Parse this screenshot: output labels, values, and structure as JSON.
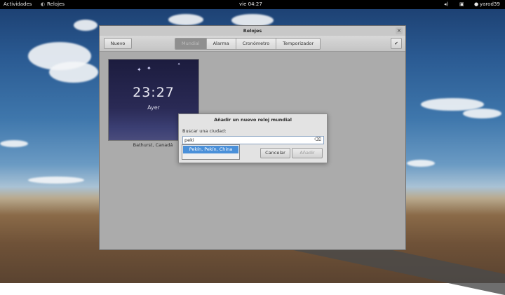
{
  "topbar": {
    "activities": "Actividades",
    "app_name": "Relojes",
    "clock": "vie 04:27",
    "user": "yarod39"
  },
  "window": {
    "title": "Relojes",
    "new_button": "Nuevo",
    "tabs": [
      {
        "label": "Mundial",
        "active": true
      },
      {
        "label": "Alarma",
        "active": false
      },
      {
        "label": "Cronómetro",
        "active": false
      },
      {
        "label": "Temporizador",
        "active": false
      }
    ],
    "select_icon": "check-icon"
  },
  "clock_tile": {
    "time": "23:27",
    "day": "Ayer",
    "city": "Bathurst, Canadá"
  },
  "dialog": {
    "title": "Añadir un nuevo reloj mundial",
    "search_label": "Buscar una ciudad:",
    "search_value": "peki",
    "cancel_label": "Cancelar",
    "add_label": "Añadir"
  },
  "suggestions": [
    {
      "label": "Pekín, Pekín, China",
      "selected": true
    }
  ]
}
